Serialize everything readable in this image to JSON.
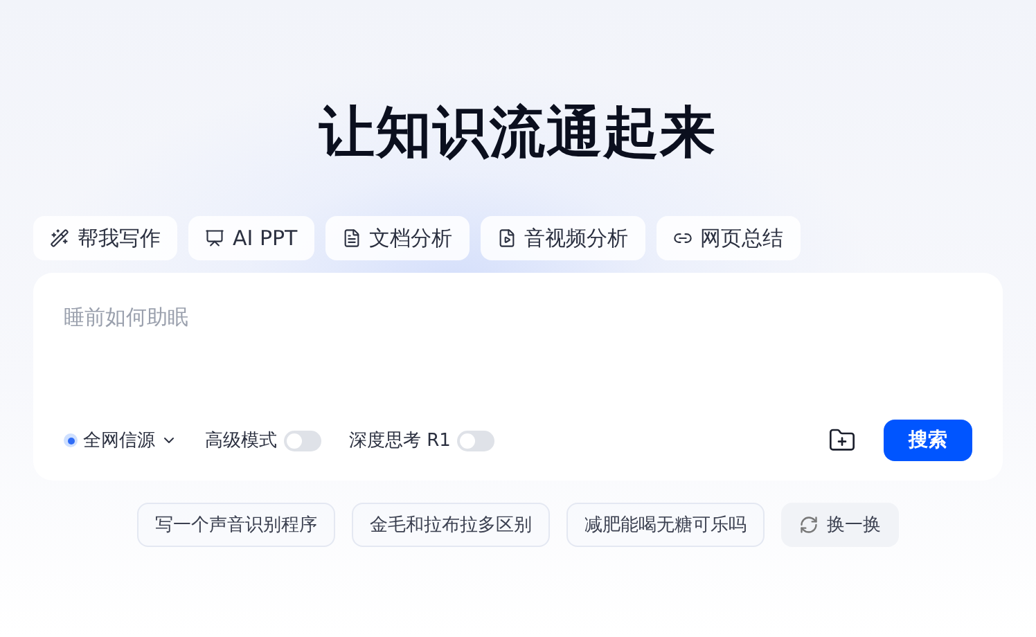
{
  "title": "让知识流通起来",
  "tools": [
    {
      "label": "帮我写作",
      "kind": "write"
    },
    {
      "label": "AI PPT",
      "kind": "ppt"
    },
    {
      "label": "文档分析",
      "kind": "doc"
    },
    {
      "label": "音视频分析",
      "kind": "media"
    },
    {
      "label": "网页总结",
      "kind": "link"
    }
  ],
  "search": {
    "placeholder": "睡前如何助眠"
  },
  "options": [
    {
      "kind": "source",
      "label": "全网信源"
    },
    {
      "kind": "toggle",
      "label": "高级模式",
      "on": false
    },
    {
      "kind": "toggle",
      "label": "深度思考 R1",
      "on": false
    }
  ],
  "submit": "搜索",
  "suggestions": [
    {
      "label": "写一个声音识别程序",
      "kind": "query"
    },
    {
      "label": "金毛和拉布拉多区别",
      "kind": "query"
    },
    {
      "label": "减肥能喝无糖可乐吗",
      "kind": "query"
    },
    {
      "label": "换一换",
      "kind": "refresh"
    }
  ]
}
